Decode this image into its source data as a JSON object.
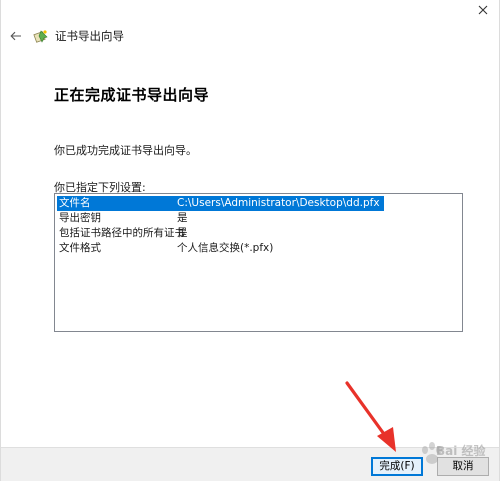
{
  "window": {
    "title": "证书导出向导"
  },
  "main": {
    "heading": "正在完成证书导出向导",
    "success_text": "你已成功完成证书导出向导。",
    "settings_label": "你已指定下列设置:",
    "settings": [
      {
        "name": "文件名",
        "value": "C:\\Users\\Administrator\\Desktop\\dd.pfx",
        "selected": true
      },
      {
        "name": "导出密钥",
        "value": "是",
        "selected": false
      },
      {
        "name": "包括证书路径中的所有证书",
        "value": "是",
        "selected": false
      },
      {
        "name": "文件格式",
        "value": "个人信息交换(*.pfx)",
        "selected": false
      }
    ]
  },
  "footer": {
    "finish_label": "完成(F)",
    "cancel_label": "取消"
  },
  "watermark": {
    "text": "Bai 经验"
  },
  "colors": {
    "selection": "#0078d7",
    "annotation_arrow": "#e8322a"
  }
}
